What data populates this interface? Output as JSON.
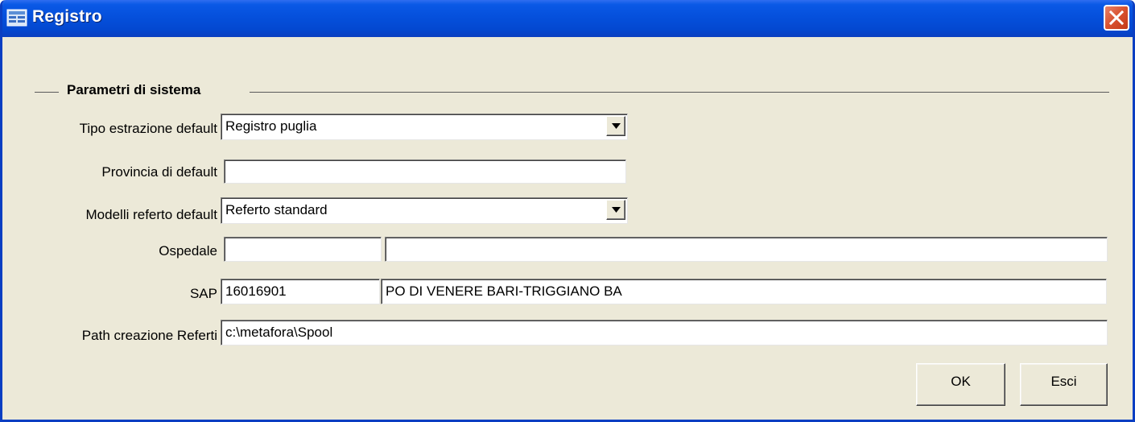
{
  "window": {
    "title": "Registro"
  },
  "group": {
    "title": "Parametri di sistema"
  },
  "fields": {
    "tipo_estrazione": {
      "label": "Tipo estrazione default",
      "value": "Registro puglia"
    },
    "provincia": {
      "label": "Provincia di default",
      "value": ""
    },
    "modelli_referto": {
      "label": "Modelli referto default",
      "value": "Referto standard"
    },
    "ospedale": {
      "label": "Ospedale",
      "code": "",
      "name": ""
    },
    "sap": {
      "label": "SAP",
      "code": "16016901",
      "name": "PO DI VENERE BARI-TRIGGIANO BA"
    },
    "path": {
      "label": "Path creazione Referti",
      "value": "c:\\metafora\\Spool"
    }
  },
  "buttons": {
    "ok": "OK",
    "esci": "Esci"
  },
  "icons": {
    "app": "registry-app-icon",
    "close": "close-icon",
    "dropdown": "dropdown-arrow-icon"
  },
  "colors": {
    "titlebar": "#0550dc",
    "dialog_bg": "#ece9d8",
    "close": "#d8512e"
  }
}
